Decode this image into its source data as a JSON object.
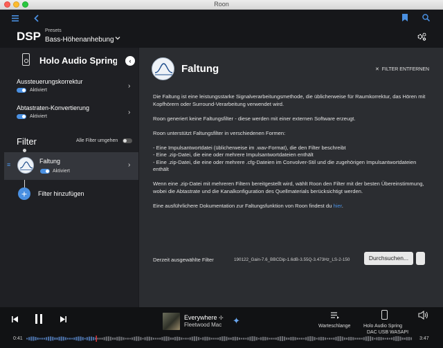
{
  "window": {
    "title": "Roon"
  },
  "header": {
    "title": "DSP",
    "presets_label": "Presets",
    "preset_value": "Bass-Höhenanhebung",
    "accent": "#4a90e2"
  },
  "left": {
    "device_name": "Holo Audio Spring",
    "settings": [
      {
        "title": "Aussteuerungskorrektur",
        "state": "Aktiviert"
      },
      {
        "title": "Abtastraten-Konvertierung",
        "state": "Aktiviert"
      }
    ],
    "filter_heading": "Filter",
    "bypass_label": "Alle Filter umgehen",
    "filters": [
      {
        "name": "Faltung",
        "state": "Aktiviert"
      }
    ],
    "add_filter_label": "Filter hinzufügen"
  },
  "right": {
    "title": "Faltung",
    "remove_label": "FILTER ENTFERNEN",
    "paragraphs": [
      "Die Faltung ist eine leistungsstarke Signalverarbeitungsmethode, die üblicherweise für Raumkorrektur, das Hören mit Kopfhörern oder Surround-Verarbeitung verwendet wird.",
      "Roon generiert keine Faltungsfilter - diese werden mit einer externen Software erzeugt.",
      "Roon unterstützt Faltungsfilter in verschiedenen Formen:",
      "- Eine Impulsantwortdatei (üblicherweise im .wav-Format), die den Filter beschreibt",
      "- Eine .zip-Datei, die eine oder mehrere Impulsantwortdateien enthält",
      "- Eine .zip-Datei, die eine oder mehrere .cfg-Dateien im Convolver-Stil und die zugehörigen Impulsantwortdateien enthält",
      "Wenn eine .zip-Datei mit mehreren Filtern bereitgestellt wird, wählt Roon den Filter mit der besten Übereinstimmung, wobei die Abtastrate und die Kanalkonfiguration des Quellmaterials berücksichtigt werden.",
      "Eine ausführlichere Dokumentation zur Faltungsfunktion von Roon findest du"
    ],
    "doc_link": "hier",
    "current_label": "Derzeit ausgewählte Filter",
    "current_value": "190122_Gain-7.6_BBCDip-1.6dB-3.55Q-3.473Hz_LS-2-150",
    "browse_label": "Durchsuchen..."
  },
  "player": {
    "track": "Everywhere",
    "artist": "Fleetwood Mac",
    "queue_label": "Warteschlange",
    "zone_name": "Holo Audio Spring",
    "zone_output": "DAC USB WASAPI",
    "elapsed": "0:41",
    "duration": "3:47",
    "progress": 0.18
  }
}
